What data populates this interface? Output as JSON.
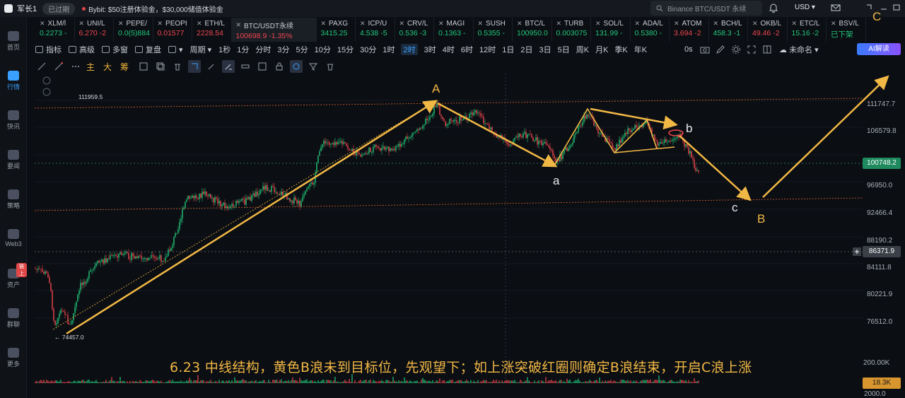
{
  "titlebar": {
    "user": "军长1",
    "expired_badge": "已过期",
    "promo": "Bybit: $50注册体验金，$30,000储值体验金",
    "search_placeholder": "Binance BTC/USDT 永续",
    "currency": "USD"
  },
  "rail": {
    "items": [
      {
        "label": "首页",
        "icon": "home-icon"
      },
      {
        "label": "行情",
        "icon": "market-chart-icon",
        "active": true
      },
      {
        "label": "快讯",
        "icon": "flash-news-icon"
      },
      {
        "label": "要闻",
        "icon": "news-icon"
      },
      {
        "label": "策略",
        "icon": "strategy-icon"
      },
      {
        "label": "Web3",
        "icon": "web3-icon"
      },
      {
        "label": "资产",
        "icon": "wallet-icon",
        "badge": "链上"
      },
      {
        "label": "群聊",
        "icon": "chat-icon"
      },
      {
        "label": "更多",
        "icon": "more-icon"
      }
    ]
  },
  "tickers": [
    {
      "symbol": "XLM/l",
      "price": "0.2273",
      "change": "-",
      "dir": "up"
    },
    {
      "symbol": "UNI/L",
      "price": "6.270",
      "change": "-2",
      "dir": "dn"
    },
    {
      "symbol": "PEPE/",
      "price": "0.0(5)884",
      "change": "",
      "dir": "up"
    },
    {
      "symbol": "PEOPI",
      "price": "0.01577",
      "change": "",
      "dir": "dn"
    },
    {
      "symbol": "ETH/L",
      "price": "2228.54",
      "change": "",
      "dir": "dn"
    },
    {
      "symbol": "BTC/USDT永续",
      "price": "100698.9",
      "change": "-1.35%",
      "dir": "dn",
      "active": true
    },
    {
      "symbol": "PAXG",
      "price": "3415.25",
      "change": "",
      "dir": "up"
    },
    {
      "symbol": "ICP/U",
      "price": "4.538",
      "change": "-5",
      "dir": "up"
    },
    {
      "symbol": "CRV/L",
      "price": "0.536",
      "change": "-3",
      "dir": "up"
    },
    {
      "symbol": "MAGI",
      "price": "0.1363",
      "change": "-",
      "dir": "up"
    },
    {
      "symbol": "SUSH",
      "price": "0.5355",
      "change": "-",
      "dir": "up"
    },
    {
      "symbol": "BTC/L",
      "price": "100950.0",
      "change": "",
      "dir": "up"
    },
    {
      "symbol": "TURB",
      "price": "0.003075",
      "change": "",
      "dir": "up"
    },
    {
      "symbol": "SOL/L",
      "price": "131.99",
      "change": "-",
      "dir": "up"
    },
    {
      "symbol": "ADA/L",
      "price": "0.5380",
      "change": "-",
      "dir": "up"
    },
    {
      "symbol": "ATOM",
      "price": "3.694",
      "change": "-2",
      "dir": "dn"
    },
    {
      "symbol": "BCH/L",
      "price": "458.3",
      "change": "-1",
      "dir": "up"
    },
    {
      "symbol": "OKB/L",
      "price": "49.46",
      "change": "-2",
      "dir": "dn"
    },
    {
      "symbol": "ETC/L",
      "price": "15.16",
      "change": "-2",
      "dir": "up"
    },
    {
      "symbol": "BSV/L",
      "price": "已下架",
      "change": "",
      "dir": "up"
    }
  ],
  "toolbar": {
    "indicators": "指标",
    "advanced": "高级",
    "multi": "多窗",
    "replay": "复盘",
    "period": "周期",
    "timeframes": [
      "1秒",
      "1分",
      "分时",
      "3分",
      "5分",
      "10分",
      "15分",
      "30分",
      "1时",
      "2时",
      "3时",
      "4时",
      "6时",
      "12时",
      "1日",
      "2日",
      "3日",
      "5日",
      "周K",
      "月K",
      "季K",
      "年K"
    ],
    "selected_timeframe": "2时",
    "countdown": "0s",
    "layout": "未命名",
    "ai_button": "AI解读"
  },
  "drawbar": {
    "chars": [
      "主",
      "大",
      "筹"
    ]
  },
  "chart": {
    "caption": "6.23 中线结构，黄色B浪未到目标位，先观望下；如上涨突破红圈则确定B浪结束，开启C浪上涨",
    "price_labels": [
      "111747.7",
      "106579.8",
      "100748.2",
      "96950.0",
      "92466.4",
      "88190.2",
      "86371.9",
      "84111.8",
      "80221.9",
      "76512.0"
    ],
    "current_price": "100748.2",
    "crosshair_price": "86371.9",
    "high_label": "111959.5",
    "low_label": "74457.0",
    "volume_labels": [
      "200.00K",
      "18.3K",
      "2000.0"
    ],
    "wave_labels": {
      "A": "A",
      "B": "B",
      "C": "C",
      "a": "a",
      "b": "b",
      "c": "c"
    },
    "colors": {
      "up": "#21c77a",
      "down": "#f0474f",
      "wave": "#f2b845",
      "channel": "#d9642e",
      "current_price": "#2f8f6b"
    }
  }
}
